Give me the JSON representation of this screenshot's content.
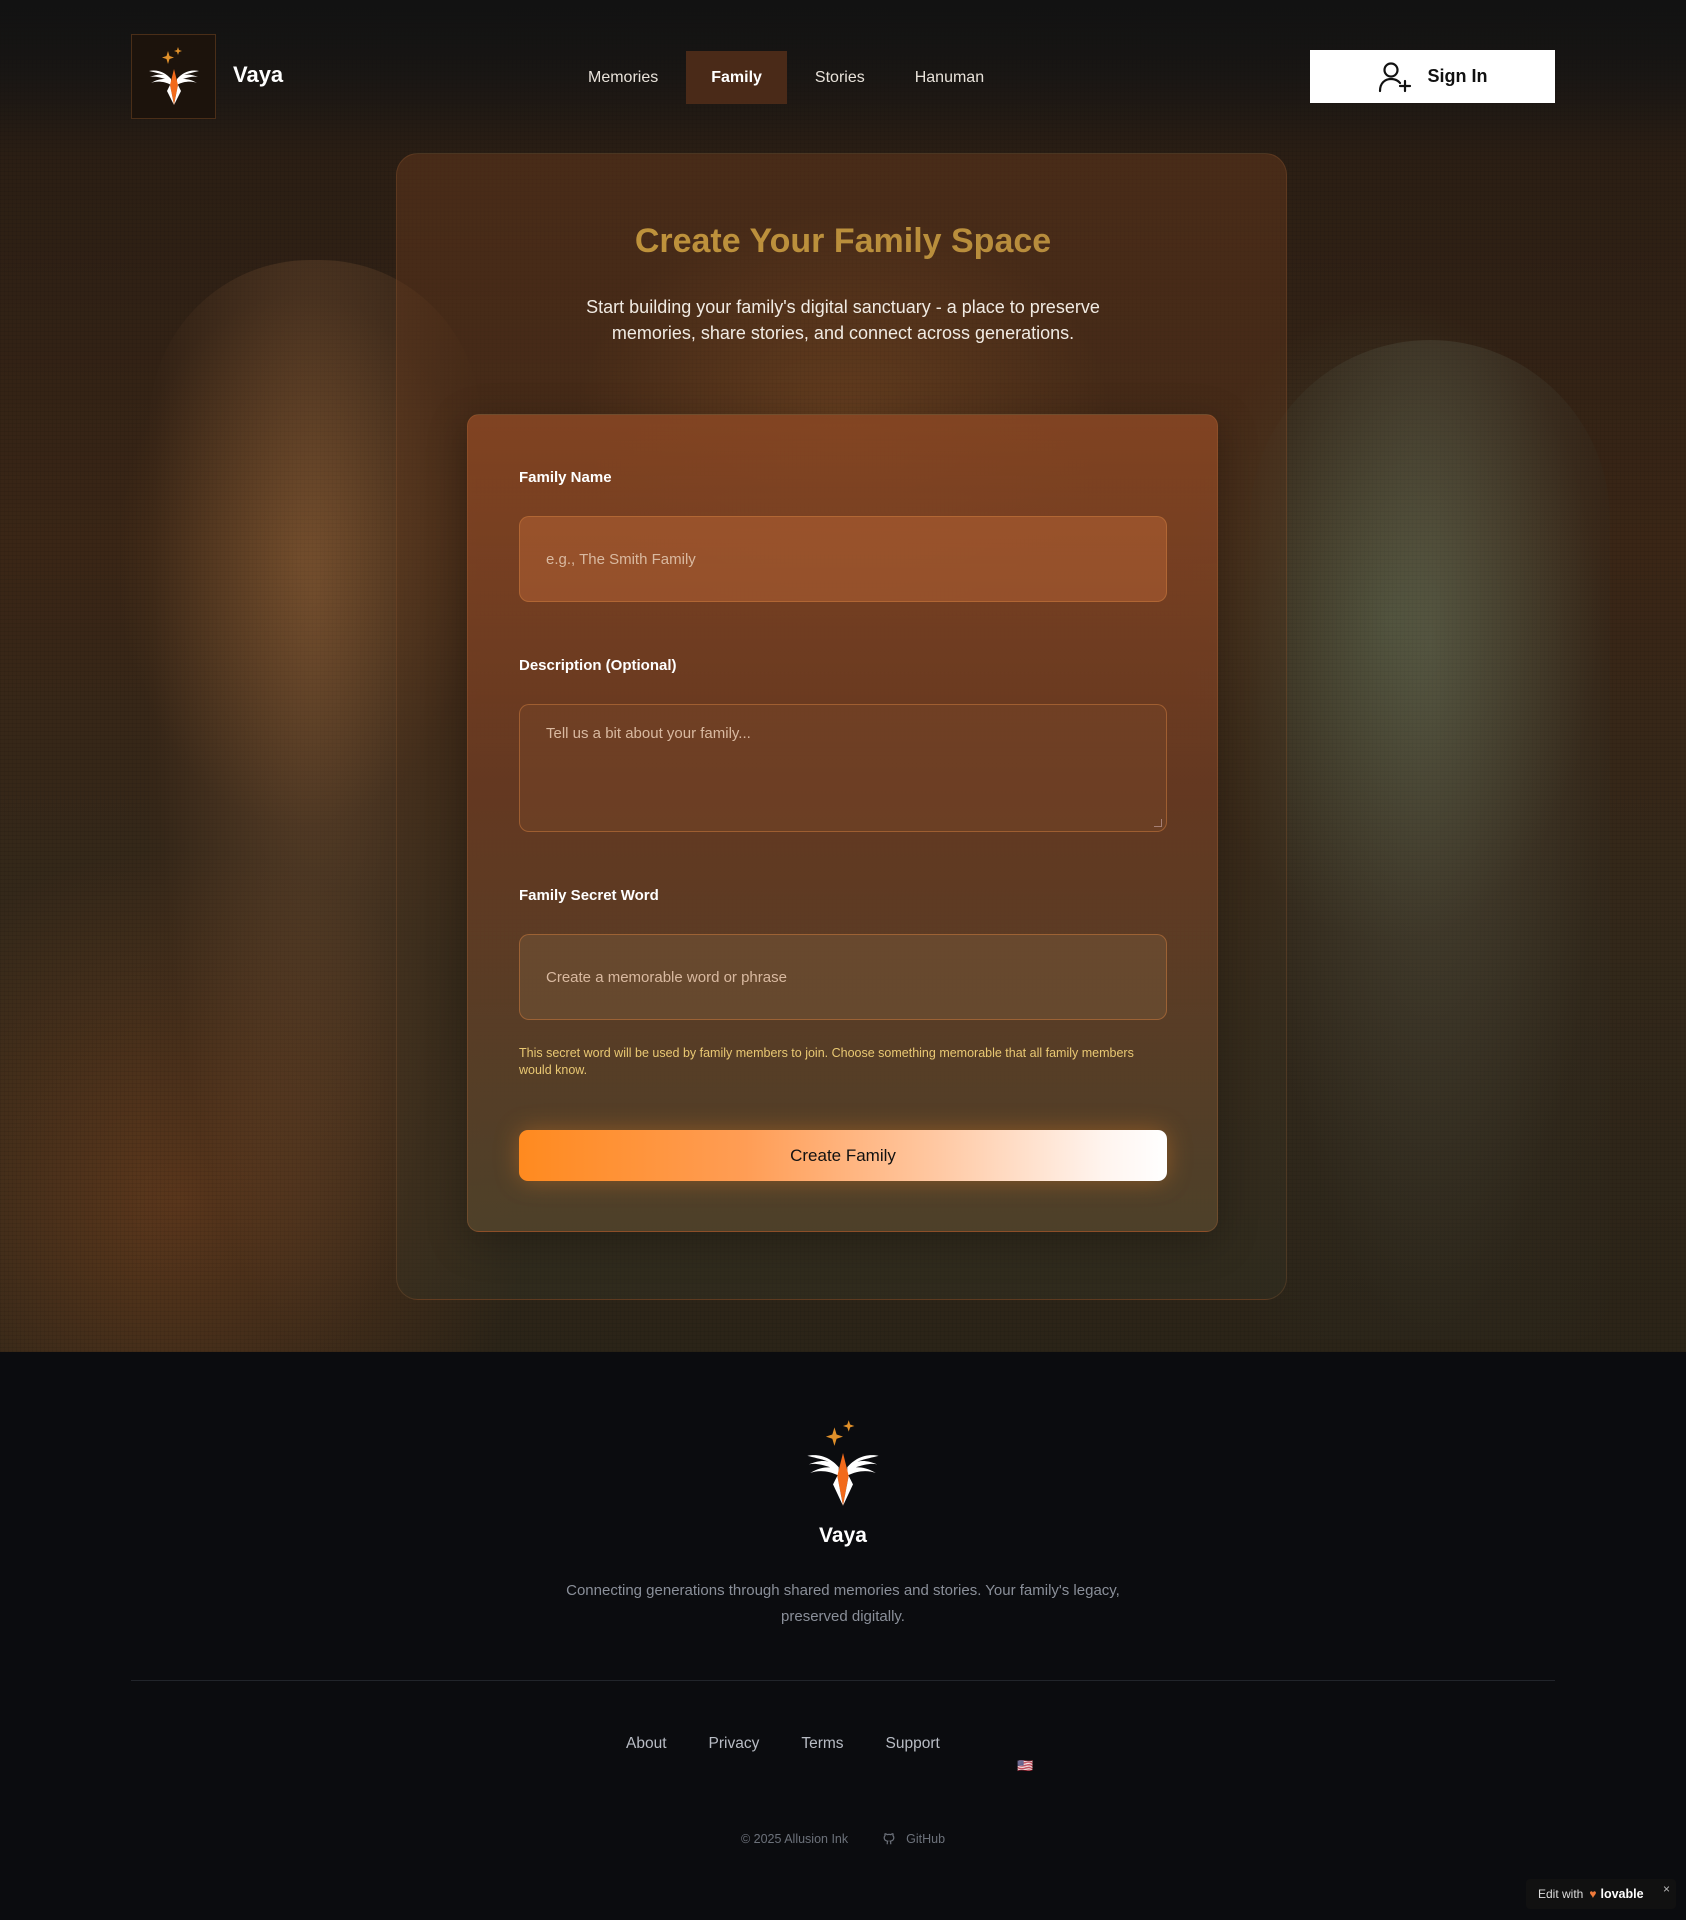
{
  "header": {
    "brand": "Vaya",
    "nav": [
      {
        "label": "Memories",
        "active": false
      },
      {
        "label": "Family",
        "active": true
      },
      {
        "label": "Stories",
        "active": false
      },
      {
        "label": "Hanuman",
        "active": false
      }
    ],
    "signin_label": "Sign In"
  },
  "main": {
    "title": "Create Your Family Space",
    "subtitle": "Start building your family's digital sanctuary - a place to preserve memories, share stories, and connect across generations."
  },
  "form": {
    "family_name_label": "Family Name",
    "family_name_placeholder": "e.g., The Smith Family",
    "family_name_value": "",
    "description_label": "Description (Optional)",
    "description_placeholder": "Tell us a bit about your family...",
    "description_value": "",
    "secret_label": "Family Secret Word",
    "secret_placeholder": "Create a memorable word or phrase",
    "secret_value": "",
    "secret_hint": "This secret word will be used by family members to join. Choose something memorable that all family members would know.",
    "submit_label": "Create Family"
  },
  "footer": {
    "brand": "Vaya",
    "tagline": "Connecting generations through shared memories and stories. Your family's legacy, preserved digitally.",
    "links": [
      "About",
      "Privacy",
      "Terms",
      "Support"
    ],
    "language_flag": "🇺🇸",
    "copyright": "© 2025 Allusion Ink",
    "github_label": "GitHub"
  },
  "badge": {
    "prefix": "Edit with",
    "brand": "lovable",
    "close": "×"
  },
  "colors": {
    "accent_orange": "#ff8a1f",
    "title_gold": "#c89a3a",
    "hint_yellow": "#e9c873",
    "nav_active_bg": "#4a2a18",
    "footer_bg": "#0b0c0f"
  }
}
